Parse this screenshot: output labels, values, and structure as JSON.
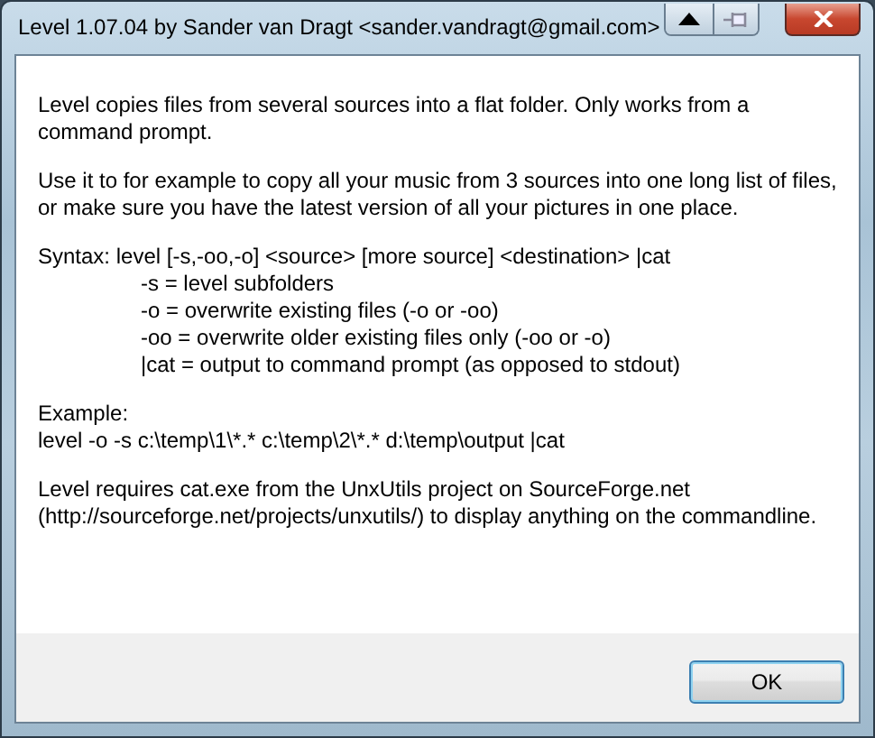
{
  "window": {
    "title": "Level 1.07.04 by Sander van Dragt <sander.vandragt@gmail.com>"
  },
  "blocks": [
    {
      "kind": "para",
      "text": "Level copies files from several sources into a flat folder. Only works from a command prompt."
    },
    {
      "kind": "para",
      "text": "Use it to for example to copy all your music from 3 sources into one long list of files, or make sure you have the latest version of all your pictures in one place."
    },
    {
      "kind": "syntax",
      "text": "Syntax: level [-s,-oo,-o] <source> [more source] <destination> |cat",
      "options": [
        "-s = level subfolders",
        "-o = overwrite existing files (-o or -oo)",
        "-oo = overwrite older existing files only (-oo or -o)",
        "|cat = output to command prompt (as opposed to stdout)"
      ]
    },
    {
      "kind": "example",
      "text": "Example:",
      "command": "level -o -s c:\\temp\\1\\*.* c:\\temp\\2\\*.* d:\\temp\\output |cat"
    },
    {
      "kind": "para",
      "text": "Level requires cat.exe from the UnxUtils project on SourceForge.net (http://sourceforge.net/projects/unxutils/) to display anything on the commandline."
    }
  ],
  "buttons": [
    {
      "label": "OK"
    }
  ]
}
